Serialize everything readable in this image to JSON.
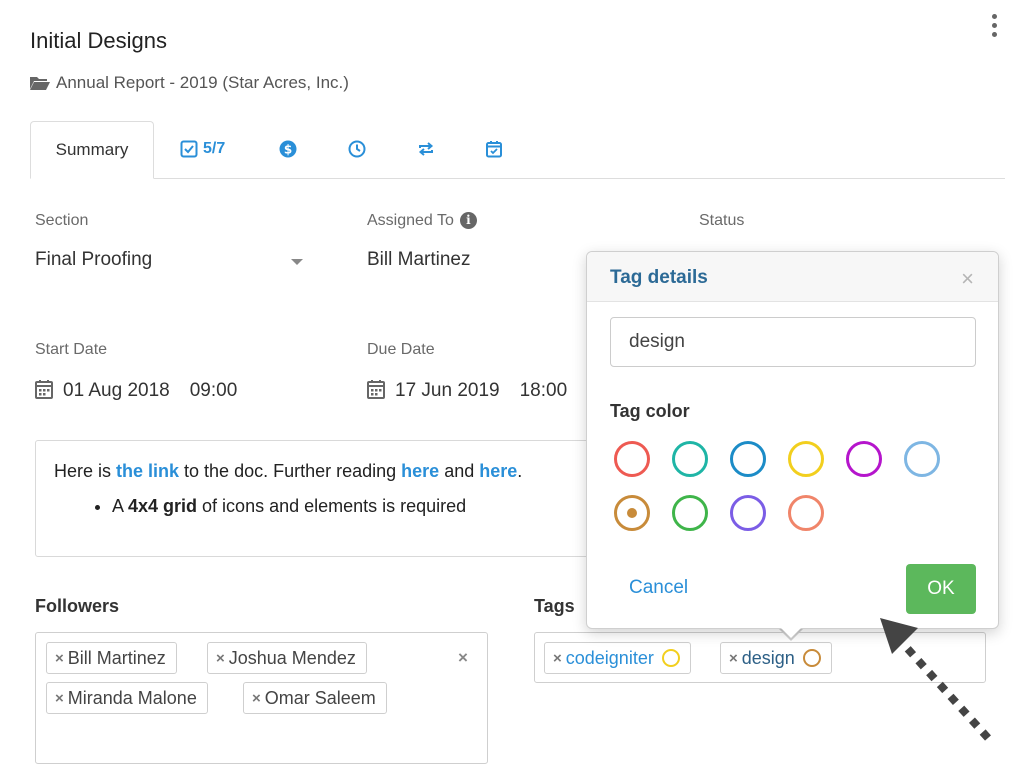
{
  "page": {
    "title": "Initial Designs",
    "breadcrumb": "Annual Report - 2019 (Star Acres, Inc.)"
  },
  "tabs": {
    "summary": "Summary",
    "checklist_count": "5/7"
  },
  "fields": {
    "section": {
      "label": "Section",
      "value": "Final Proofing"
    },
    "assigned": {
      "label": "Assigned To",
      "value": "Bill Martinez"
    },
    "status": {
      "label": "Status"
    },
    "start": {
      "label": "Start Date",
      "date": "01 Aug 2018",
      "time": "09:00"
    },
    "due": {
      "label": "Due Date",
      "date": "17 Jun 2019",
      "time": "18:00"
    }
  },
  "description": {
    "t1": "Here is ",
    "link1": "the link",
    "t2": " to the doc. Further reading ",
    "link2": "here",
    "t3": " and ",
    "link3": "here",
    "t4": ".",
    "bullet_a": "A ",
    "bullet_bold": "4x4 grid",
    "bullet_rest": " of icons and elements is required"
  },
  "followers": {
    "label": "Followers",
    "items": [
      "Bill Martinez",
      "Joshua Mendez",
      "Miranda Malone",
      "Omar Saleem"
    ],
    "remove": "×",
    "clear": "×"
  },
  "tags": {
    "label": "Tags",
    "items": [
      {
        "name": "codeigniter",
        "color": "#f2cf1e"
      },
      {
        "name": "design",
        "color": "#c88b3a"
      }
    ]
  },
  "popover": {
    "title": "Tag details",
    "close": "×",
    "input_value": "design",
    "color_label": "Tag color",
    "colors": [
      "#ee5a52",
      "#1fb5a6",
      "#1c8cc7",
      "#f2cf1e",
      "#b515cc",
      "#7eb6e3",
      "#c88b3a",
      "#3fb54a",
      "#7b5de6",
      "#f0856a"
    ],
    "selected_color": "#c88b3a",
    "cancel": "Cancel",
    "ok": "OK"
  },
  "colors": {
    "accent": "#2a8fd8",
    "ok_green": "#5cb85c"
  }
}
